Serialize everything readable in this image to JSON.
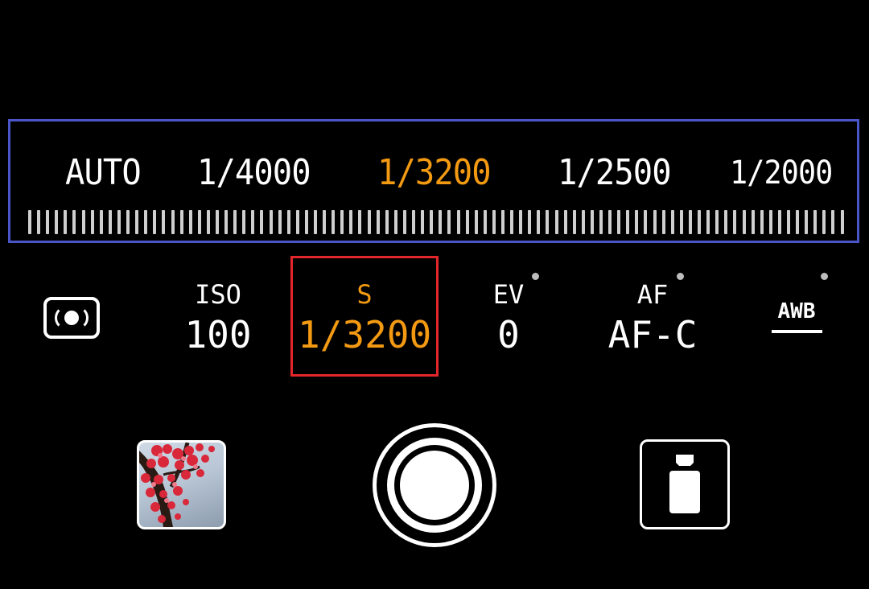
{
  "shutter_dial": {
    "options": [
      {
        "label": "AUTO",
        "selected": false
      },
      {
        "label": "1/4000",
        "selected": false
      },
      {
        "label": "1/3200",
        "selected": true
      },
      {
        "label": "1/2500",
        "selected": false
      },
      {
        "label": "1/2000",
        "selected": false
      }
    ]
  },
  "params": {
    "metering": {
      "icon": "metering-mode-icon"
    },
    "iso": {
      "label": "ISO",
      "value": "100"
    },
    "shutter": {
      "label": "S",
      "value": "1/3200"
    },
    "ev": {
      "label": "EV",
      "value": "0"
    },
    "af": {
      "label": "AF",
      "value": "AF-C"
    },
    "wb": {
      "label": "AWB"
    }
  },
  "controls": {
    "gallery": {
      "icon": "gallery-thumbnail"
    },
    "shutter": {
      "icon": "shutter-button"
    },
    "lens": {
      "icon": "lens-switch-icon"
    }
  },
  "colors": {
    "accent": "#f39a12",
    "dial_border": "#4a56c8",
    "highlight_border": "#e3262a",
    "background": "#000000",
    "text": "#ffffff"
  }
}
